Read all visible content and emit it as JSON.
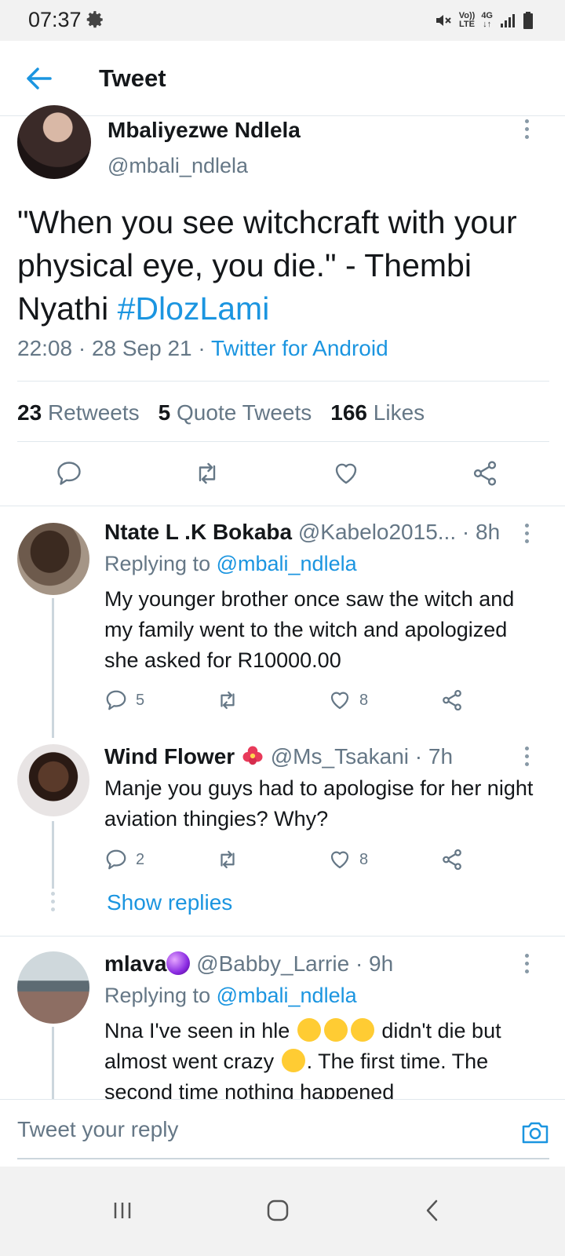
{
  "status_bar": {
    "time": "07:37",
    "vol_label": "Vo))",
    "lte_label": "LTE",
    "net_label": "4G"
  },
  "header": {
    "title": "Tweet"
  },
  "main_tweet": {
    "author_name": "Mbaliyezwe Ndlela",
    "author_handle": "@mbali_ndlela",
    "text": "\"When you see witchcraft with your physical eye, you die.\" - Thembi Nyathi ",
    "hashtag": "#DlozLami",
    "timestamp": "22:08 · 28 Sep 21 · ",
    "source": "Twitter for Android",
    "retweets_count": "23",
    "retweets_label": "Retweets",
    "quotes_count": "5",
    "quotes_label": "Quote Tweets",
    "likes_count": "166",
    "likes_label": "Likes"
  },
  "replies": [
    {
      "name": "Ntate L .K Bokaba",
      "handle": "@Kabelo2015... · 8h",
      "replying_prefix": "Replying to ",
      "replying_to": "@mbali_ndlela",
      "text": "My younger brother once saw the witch and my family went to the witch and apologized she asked for R10000.00",
      "reply_count": "5",
      "like_count": "8"
    },
    {
      "name": "Wind Flower",
      "handle": "@Ms_Tsakani · 7h",
      "text": "Manje you guys had to apologise for her night aviation thingies? Why?",
      "reply_count": "2",
      "like_count": "8",
      "show_replies": "Show replies"
    },
    {
      "name": "mlava",
      "handle": "@Babby_Larrie · 9h",
      "replying_prefix": "Replying to ",
      "replying_to": "@mbali_ndlela",
      "text_part1": "Nna I've seen in hle ",
      "text_part2": " didn't die but almost went crazy ",
      "text_part3": ". The first time. The second time nothing happened"
    }
  ],
  "composer": {
    "placeholder": "Tweet your reply"
  },
  "colors": {
    "accent": "#1b95e0",
    "secondary_text": "#657786",
    "divider": "#e1e8ed"
  }
}
